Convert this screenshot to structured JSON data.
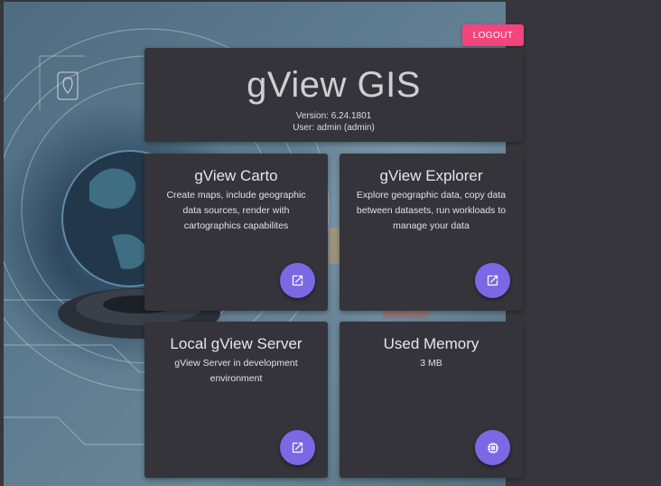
{
  "header": {
    "title": "gView GIS",
    "version": "Version: 6.24.1801",
    "user": "User: admin (admin)"
  },
  "logout_label": "LOGOUT",
  "cards": [
    {
      "title": "gView Carto",
      "description": "Create maps, include geographic data sources, render with cartographics capabilites",
      "icon": "open-in-new-icon"
    },
    {
      "title": "gView Explorer",
      "description": "Explore geographic data, copy data between datasets, run workloads to manage your data",
      "icon": "open-in-new-icon"
    },
    {
      "title": "Local gView Server",
      "description": "gView Server in development environment",
      "icon": "open-in-new-icon"
    },
    {
      "title": "Used Memory",
      "description": "3 MB",
      "icon": "memory-chip-icon"
    }
  ],
  "colors": {
    "accent": "#7b68e4",
    "logout": "#f2457b",
    "panel": "#35343b",
    "page": "#36363c"
  }
}
